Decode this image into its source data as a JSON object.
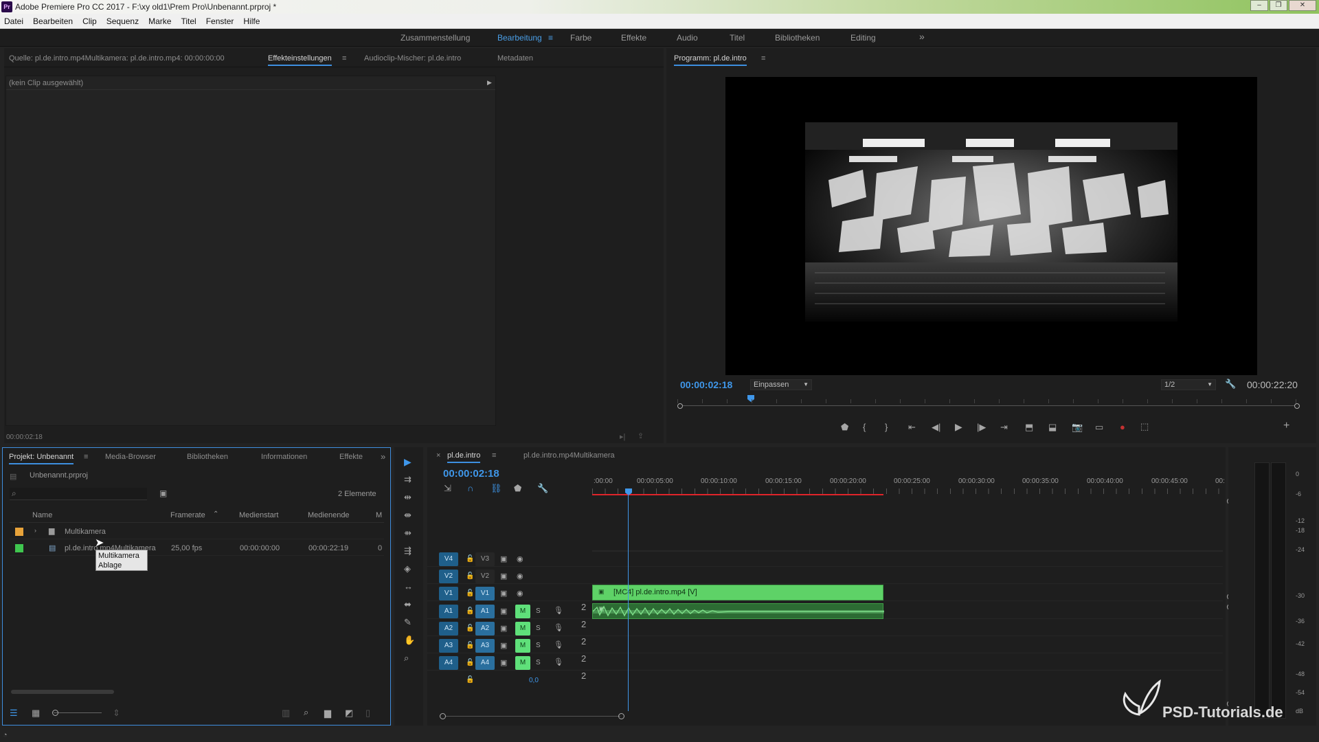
{
  "window": {
    "app_badge": "Pr",
    "title": "Adobe Premiere Pro CC 2017 - F:\\xy old1\\Prem Pro\\Unbenannt.prproj *",
    "controls": [
      "–",
      "❐",
      "✕"
    ]
  },
  "menu": [
    "Datei",
    "Bearbeiten",
    "Clip",
    "Sequenz",
    "Marke",
    "Titel",
    "Fenster",
    "Hilfe"
  ],
  "workspaces": {
    "items": [
      "Zusammenstellung",
      "Bearbeitung",
      "Farbe",
      "Effekte",
      "Audio",
      "Titel",
      "Bibliotheken",
      "Editing"
    ],
    "active": "Bearbeitung",
    "overflow": "»"
  },
  "source_panel": {
    "tabs": [
      "Quelle: pl.de.intro.mp4Multikamera: pl.de.intro.mp4: 00:00:00:00",
      "Effekteinstellungen",
      "Audioclip-Mischer: pl.de.intro",
      "Metadaten"
    ],
    "active_tab": "Effekteinstellungen",
    "no_clip_text": "(kein Clip ausgewählt)",
    "timecode": "00:00:02:18"
  },
  "program_panel": {
    "title": "Programm: pl.de.intro",
    "current_time": "00:00:02:18",
    "fit_select": "Einpassen",
    "resolution_select": "1/2",
    "duration": "00:00:22:20",
    "playhead_fraction": 0.113
  },
  "project_panel": {
    "tabs": [
      "Projekt: Unbenannt",
      "Media-Browser",
      "Bibliotheken",
      "Informationen",
      "Effekte"
    ],
    "active_tab": "Projekt: Unbenannt",
    "project_file": "Unbenannt.prproj",
    "search_placeholder": "",
    "item_count": "2 Elemente",
    "columns": [
      "Name",
      "Framerate",
      "Medienstart",
      "Medienende",
      "M"
    ],
    "rows": [
      {
        "name": "Multikamera",
        "type": "bin",
        "label_color": "#e8a33a",
        "framerate": "",
        "start": "",
        "end": "",
        "m": ""
      },
      {
        "name": "pl.de.intro.mp4Multikamera",
        "type": "sequence",
        "label_color": "#3fc64f",
        "framerate": "25,00 fps",
        "start": "00:00:00:00",
        "end": "00:00:22:19",
        "m": "0"
      }
    ],
    "tooltip": [
      "Multikamera",
      "Ablage"
    ]
  },
  "timeline": {
    "tabs": [
      "pl.de.intro",
      "pl.de.intro.mp4Multikamera"
    ],
    "active_tab": "pl.de.intro",
    "close_glyph": "×",
    "timecode": "00:00:02:18",
    "ruler_labels": [
      ":00:00",
      "00:00:05:00",
      "00:00:10:00",
      "00:00:15:00",
      "00:00:20:00",
      "00:00:25:00",
      "00:00:30:00",
      "00:00:35:00",
      "00:00:40:00",
      "00:00:45:00",
      "00:"
    ],
    "video_tracks": [
      {
        "target": "V4",
        "name": "V3"
      },
      {
        "target": "V2",
        "name": "V2"
      },
      {
        "target": "V1",
        "name": "V1"
      }
    ],
    "audio_tracks": [
      {
        "target": "A1",
        "name": "A1",
        "mute": "M",
        "solo": "S"
      },
      {
        "target": "A2",
        "name": "A2",
        "mute": "M",
        "solo": "S"
      },
      {
        "target": "A3",
        "name": "A3",
        "mute": "M",
        "solo": "S"
      },
      {
        "target": "A4",
        "name": "A4",
        "mute": "M",
        "solo": "S"
      }
    ],
    "audio_channel_marks": [
      "2",
      "2",
      "2",
      "2",
      "2"
    ],
    "master_volume": "0,0",
    "video_clip_label": "[MC4] pl.de.intro.mp4 [V]"
  },
  "audio_meter": {
    "labels": [
      "0",
      "-6",
      "-12",
      "-18",
      "-24",
      "-30",
      "-36",
      "-42",
      "-48",
      "-54",
      "dB"
    ]
  },
  "watermark": "PSD-Tutorials.de",
  "colors": {
    "accent": "#3f97ea",
    "clip_green": "#5ed267",
    "workspace_active": "#4a9fe8",
    "work_area": "#e0242a"
  }
}
